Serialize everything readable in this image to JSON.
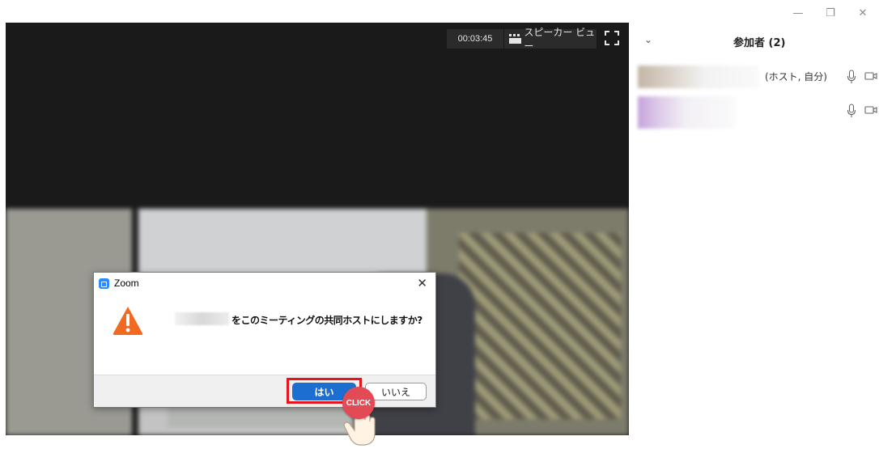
{
  "window": {
    "minimize_glyph": "—",
    "restore_glyph": "❐",
    "close_glyph": "✕"
  },
  "meeting": {
    "timer": "00:03:45",
    "speaker_view_label": "スピーカー ビュー"
  },
  "dialog": {
    "title": "Zoom",
    "close_glyph": "✕",
    "message": "をこのミーティングの共同ホストにしますか?",
    "yes_label": "はい",
    "no_label": "いいえ"
  },
  "cursor": {
    "badge_label": "CLICK"
  },
  "participants": {
    "title": "参加者 (2)",
    "collapse_glyph": "⌄",
    "items": [
      {
        "role": "(ホスト, 自分)"
      },
      {
        "role": ""
      }
    ]
  },
  "colors": {
    "accent_blue": "#1c6fd1",
    "highlight_red": "#e8131b",
    "warning_orange": "#f26a21",
    "zoom_blue": "#2d8cff"
  }
}
